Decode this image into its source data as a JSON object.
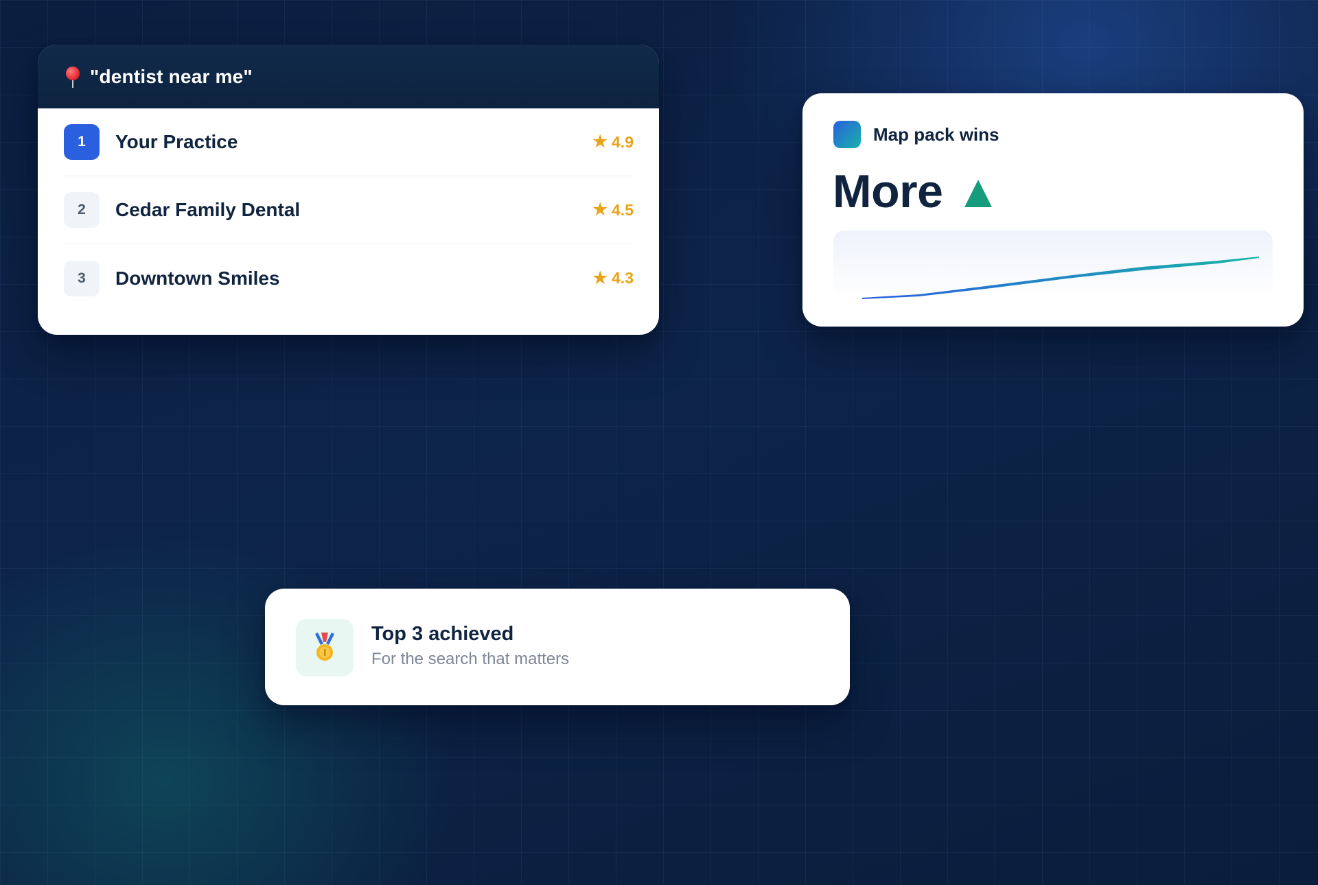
{
  "search_card": {
    "query": "\"dentist near me\"",
    "results": [
      {
        "rank": "1",
        "name": "Your Practice",
        "rating": "4.9",
        "highlighted": true
      },
      {
        "rank": "2",
        "name": "Cedar Family Dental",
        "rating": "4.5",
        "highlighted": false
      },
      {
        "rank": "3",
        "name": "Downtown Smiles",
        "rating": "4.3",
        "highlighted": false
      }
    ],
    "star_glyph": "★",
    "pin_icon": "map-pin-icon"
  },
  "map_card": {
    "title": "Map pack wins",
    "value": "More",
    "trend": "up",
    "trend_color": "#169c7c",
    "sparkline_colors": [
      "#2a5fe0",
      "#17b3a6"
    ]
  },
  "achievement_card": {
    "icon": "medal-icon",
    "title": "Top 3 achieved",
    "subtitle": "For the search that matters"
  },
  "colors": {
    "accent_blue": "#2a5fe0",
    "star_gold": "#e8a317",
    "text_dark": "#10243f",
    "background": "#0d2449"
  }
}
